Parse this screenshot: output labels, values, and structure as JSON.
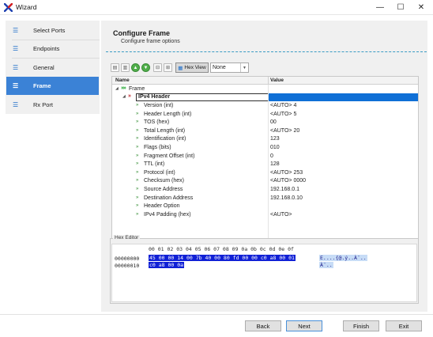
{
  "window": {
    "title": "Wizard",
    "minimize": "—",
    "maximize": "☐",
    "close": "✕"
  },
  "sidebar": {
    "items": [
      {
        "label": "Select Ports",
        "icon": "list-icon"
      },
      {
        "label": "Endpoints",
        "icon": "list-icon"
      },
      {
        "label": "General",
        "icon": "list-icon"
      },
      {
        "label": "Frame",
        "icon": "list-icon",
        "active": true
      },
      {
        "label": "Rx Port",
        "icon": "list-icon"
      }
    ]
  },
  "header": {
    "title": "Configure Frame",
    "subtitle": "Configure frame options"
  },
  "toolbar": {
    "hex_view_label": "Hex View",
    "select_value": "None"
  },
  "grid": {
    "columns": {
      "name": "Name",
      "value": "Value"
    },
    "frame_label": "Frame",
    "header_label": "IPv4 Header",
    "fields": [
      {
        "name": "Version (int)",
        "value": "<AUTO> 4"
      },
      {
        "name": "Header Length (int)",
        "value": "<AUTO> 5"
      },
      {
        "name": "TOS (hex)",
        "value": "00"
      },
      {
        "name": "Total Length (int)",
        "value": "<AUTO> 20"
      },
      {
        "name": "Identification  (int)",
        "value": "123"
      },
      {
        "name": "Flags (bits)",
        "value": "010"
      },
      {
        "name": "Fragment Offset (int)",
        "value": "0"
      },
      {
        "name": "TTL (int)",
        "value": "128"
      },
      {
        "name": "Protocol (int)",
        "value": "<AUTO> 253"
      },
      {
        "name": "Checksum (hex)",
        "value": "<AUTO> 0000"
      },
      {
        "name": "Source Address",
        "value": "192.168.0.1"
      },
      {
        "name": "Destination Address",
        "value": "192.168.0.10"
      },
      {
        "name": "Header Option",
        "value": ""
      },
      {
        "name": "IPv4 Padding (hex)",
        "value": "<AUTO>"
      }
    ]
  },
  "hex_editor": {
    "label": "Hex Editor",
    "columns": "00 01 02 03 04 05 06 07 08 09 0a 0b 0c 0d 0e 0f",
    "lines": [
      {
        "offset": "00000000",
        "bytes": "45 00 00 14 00 7b 40 00 80 fd 00 00 c0 a8 00 01",
        "ascii": "E....{@.ý..À¨.."
      },
      {
        "offset": "00000010",
        "bytes": "c0 a8 00 0a",
        "ascii": "À¨.."
      }
    ]
  },
  "footer": {
    "back": "Back",
    "next": "Next",
    "finish": "Finish",
    "exit": "Exit"
  }
}
